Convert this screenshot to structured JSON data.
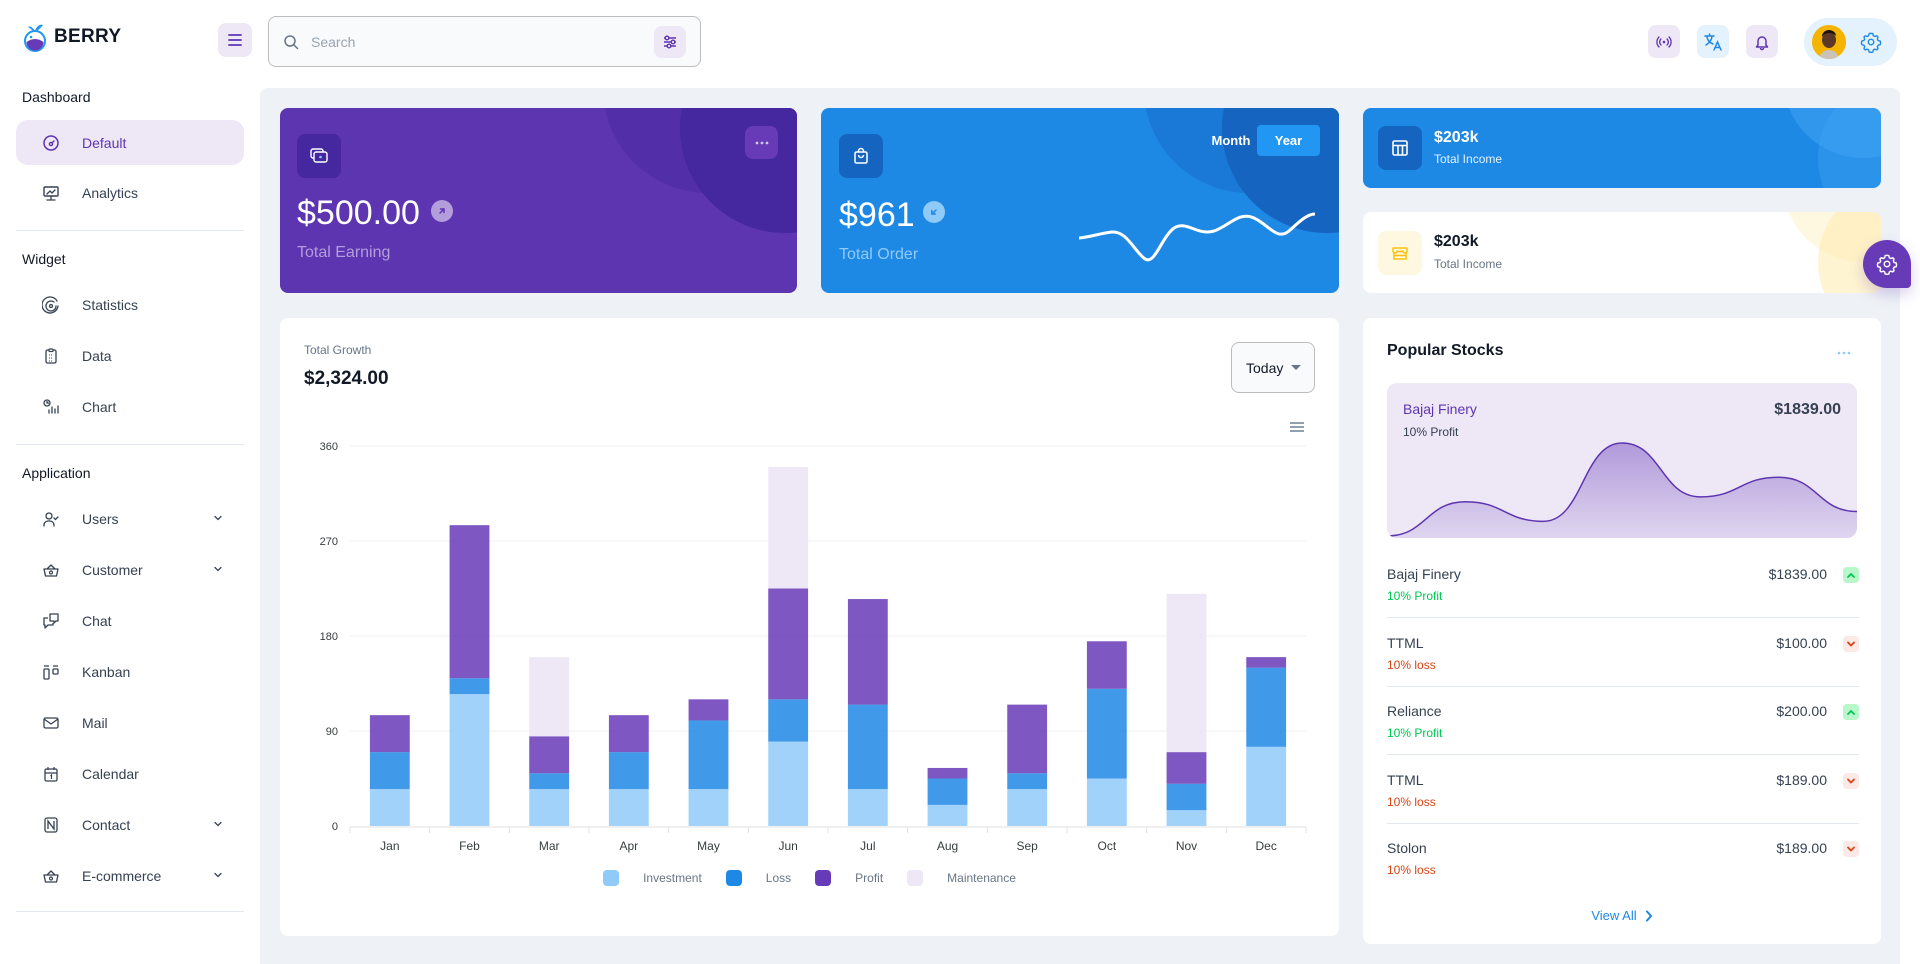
{
  "brand": {
    "name": "BERRY"
  },
  "header": {
    "search_placeholder": "Search",
    "icons": [
      "menu-icon",
      "search-icon",
      "filter-icon",
      "broadcast-icon",
      "translate-icon",
      "bell-icon",
      "avatar",
      "settings-icon"
    ]
  },
  "sidebar": {
    "sections": [
      {
        "title": "Dashboard",
        "items": [
          {
            "label": "Default",
            "icon": "dashboard-icon",
            "active": true
          },
          {
            "label": "Analytics",
            "icon": "device-analytics-icon"
          }
        ]
      },
      {
        "title": "Widget",
        "items": [
          {
            "label": "Statistics",
            "icon": "chart-arcs-icon"
          },
          {
            "label": "Data",
            "icon": "clipboard-list-icon"
          },
          {
            "label": "Chart",
            "icon": "chart-infographic-icon"
          }
        ]
      },
      {
        "title": "Application",
        "items": [
          {
            "label": "Users",
            "icon": "user-check-icon",
            "expandable": true
          },
          {
            "label": "Customer",
            "icon": "basket-icon",
            "expandable": true
          },
          {
            "label": "Chat",
            "icon": "messages-icon"
          },
          {
            "label": "Kanban",
            "icon": "layout-kanban-icon"
          },
          {
            "label": "Mail",
            "icon": "mail-icon"
          },
          {
            "label": "Calendar",
            "icon": "calendar-icon"
          },
          {
            "label": "Contact",
            "icon": "nfc-icon",
            "expandable": true
          },
          {
            "label": "E-commerce",
            "icon": "basket-icon",
            "expandable": true
          }
        ]
      }
    ]
  },
  "cards": {
    "earning": {
      "value": "$500.00",
      "label": "Total Earning",
      "trend": "up"
    },
    "order": {
      "value": "$961",
      "label": "Total Order",
      "trend": "down",
      "toggle": [
        "Month",
        "Year"
      ],
      "selected": "Year"
    },
    "income_primary": {
      "value": "$203k",
      "label": "Total Income"
    },
    "income_secondary": {
      "value": "$203k",
      "label": "Total Income"
    }
  },
  "growth": {
    "title": "Total Growth",
    "value": "$2,324.00",
    "period_select": "Today"
  },
  "chart_data": {
    "type": "bar",
    "stacked": true,
    "title": "Total Growth",
    "categories": [
      "Jan",
      "Feb",
      "Mar",
      "Apr",
      "May",
      "Jun",
      "Jul",
      "Aug",
      "Sep",
      "Oct",
      "Nov",
      "Dec"
    ],
    "series": [
      {
        "name": "Investment",
        "color": "#90caf9",
        "values": [
          35,
          125,
          35,
          35,
          35,
          80,
          35,
          20,
          35,
          45,
          15,
          75
        ]
      },
      {
        "name": "Loss",
        "color": "#1e88e5",
        "values": [
          35,
          15,
          15,
          35,
          65,
          40,
          80,
          25,
          15,
          85,
          25,
          75
        ]
      },
      {
        "name": "Profit",
        "color": "#673ab7",
        "values": [
          35,
          145,
          35,
          35,
          20,
          105,
          100,
          10,
          65,
          45,
          30,
          10
        ]
      },
      {
        "name": "Maintenance",
        "color": "#ede7f6",
        "values": [
          0,
          0,
          75,
          0,
          0,
          115,
          0,
          0,
          0,
          0,
          150,
          0
        ]
      }
    ],
    "yticks": [
      0,
      90,
      180,
      270,
      360
    ],
    "ylim": [
      0,
      360
    ],
    "grid": true,
    "legend": "bottom",
    "xlabel": "",
    "ylabel": ""
  },
  "stocks": {
    "title": "Popular Stocks",
    "featured": {
      "name": "Bajaj Finery",
      "change": "10% Profit",
      "price": "$1839.00"
    },
    "featured_series": [
      5,
      40,
      20,
      100,
      45,
      65,
      30
    ],
    "rows": [
      {
        "name": "Bajaj Finery",
        "price": "$1839.00",
        "change": "10% Profit",
        "trend": "up"
      },
      {
        "name": "TTML",
        "price": "$100.00",
        "change": "10% loss",
        "trend": "down"
      },
      {
        "name": "Reliance",
        "price": "$200.00",
        "change": "10% Profit",
        "trend": "up"
      },
      {
        "name": "TTML",
        "price": "$189.00",
        "change": "10% loss",
        "trend": "down"
      },
      {
        "name": "Stolon",
        "price": "$189.00",
        "change": "10% loss",
        "trend": "down"
      }
    ],
    "view_all": "View All"
  },
  "colors": {
    "primary": "#5e35b1",
    "secondary": "#1e88e5",
    "success": "#00c853",
    "error": "#d84315",
    "warning": "#ffc107"
  }
}
